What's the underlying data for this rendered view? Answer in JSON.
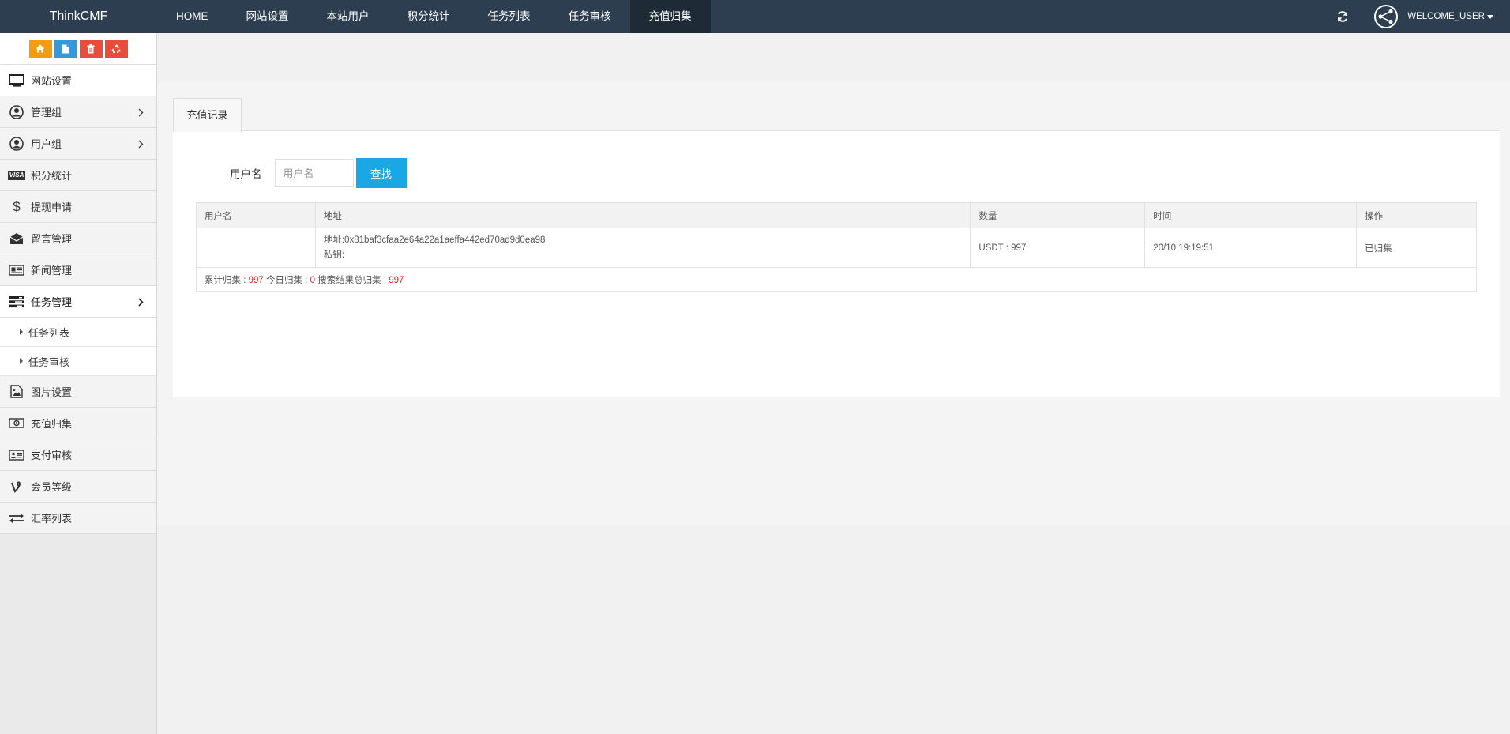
{
  "brand": "ThinkCMF",
  "topnav": [
    {
      "label": "HOME",
      "active": false
    },
    {
      "label": "网站设置",
      "active": false
    },
    {
      "label": "本站用户",
      "active": false
    },
    {
      "label": "积分统计",
      "active": false
    },
    {
      "label": "任务列表",
      "active": false
    },
    {
      "label": "任务审核",
      "active": false
    },
    {
      "label": "充值归集",
      "active": true
    }
  ],
  "user": {
    "name": "WELCOME_USER"
  },
  "sidebar": {
    "shortcuts": [
      "home-icon",
      "file-icon",
      "trash-icon",
      "recycle-icon"
    ],
    "items": [
      {
        "label": "网站设置",
        "icon": "monitor-icon"
      },
      {
        "label": "管理组",
        "icon": "user-circle-icon"
      },
      {
        "label": "用户组",
        "icon": "user-circle-icon"
      },
      {
        "label": "积分统计",
        "icon": "visa-icon"
      },
      {
        "label": "提现申请",
        "icon": "dollar-icon"
      },
      {
        "label": "留言管理",
        "icon": "envelope-icon"
      },
      {
        "label": "新闻管理",
        "icon": "newspaper-icon"
      },
      {
        "label": "任务管理",
        "icon": "tasks-icon"
      },
      {
        "label": "图片设置",
        "icon": "image-icon"
      },
      {
        "label": "充值归集",
        "icon": "money-icon"
      },
      {
        "label": "支付审核",
        "icon": "id-card-icon"
      },
      {
        "label": "会员等级",
        "icon": "vine-icon"
      },
      {
        "label": "汇率列表",
        "icon": "exchange-icon"
      }
    ],
    "subitems": [
      {
        "label": "任务列表"
      },
      {
        "label": "任务审核"
      }
    ],
    "visa_text": "VISA",
    "dollar_text": "$"
  },
  "main": {
    "tab_label": "充值记录",
    "search": {
      "label": "用户名",
      "placeholder": "用户名",
      "button": "查找"
    },
    "table": {
      "headers": [
        "用户名",
        "地址",
        "数量",
        "时间",
        "操作"
      ],
      "rows": [
        {
          "username": "",
          "address": "地址:0x81baf3cfaa2e64a22a1aeffa442ed70ad9d0ea98",
          "private_key": "私钥:",
          "amount": "USDT : 997",
          "time": "20/10 19:19:51",
          "action": "已归集"
        }
      ],
      "summary": {
        "total_label": "累计归集 : ",
        "total_value": "997",
        "today_label": " 今日归集 : ",
        "today_value": "0",
        "search_label": " 搜索结果总归集 : ",
        "search_value": "997"
      }
    }
  },
  "colors": {
    "navbar": "#2c3e50",
    "navbar_active": "#1e2b37",
    "button_blue": "#19a8e4",
    "shortcut_orange": "#f39c12",
    "shortcut_blue": "#3498db",
    "shortcut_red": "#e74c3c",
    "highlight_red": "#e02020"
  }
}
